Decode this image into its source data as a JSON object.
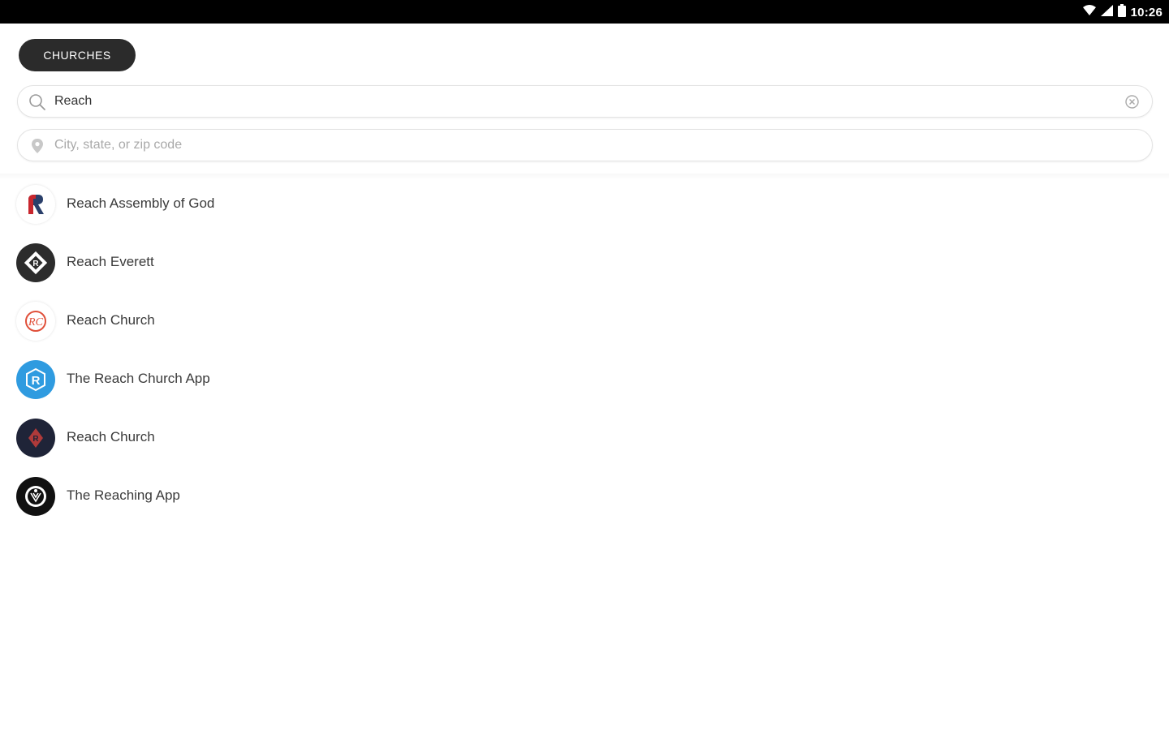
{
  "status_bar": {
    "time": "10:26",
    "icons": [
      "wifi-icon",
      "cell-signal-icon",
      "battery-icon"
    ]
  },
  "filter": {
    "label": "CHURCHES"
  },
  "search": {
    "value": "Reach",
    "icon": "search-icon",
    "clear_icon": "clear-icon"
  },
  "location": {
    "placeholder": "City, state, or zip code",
    "value": "",
    "icon": "location-pin-icon"
  },
  "results": [
    {
      "name": "Reach Assembly of God",
      "logo": "reach-assembly-logo"
    },
    {
      "name": "Reach Everett",
      "logo": "reach-everett-logo"
    },
    {
      "name": "Reach Church",
      "logo": "reach-church-rc-logo"
    },
    {
      "name": "The Reach Church App",
      "logo": "the-reach-church-app-logo"
    },
    {
      "name": "Reach Church",
      "logo": "reach-church-dark-logo"
    },
    {
      "name": "The Reaching App",
      "logo": "the-reaching-app-logo"
    }
  ],
  "colors": {
    "status_bar": "#000000",
    "pill": "#2b2b2b",
    "accent_blue": "#2f9be0",
    "accent_red": "#e0503a"
  }
}
